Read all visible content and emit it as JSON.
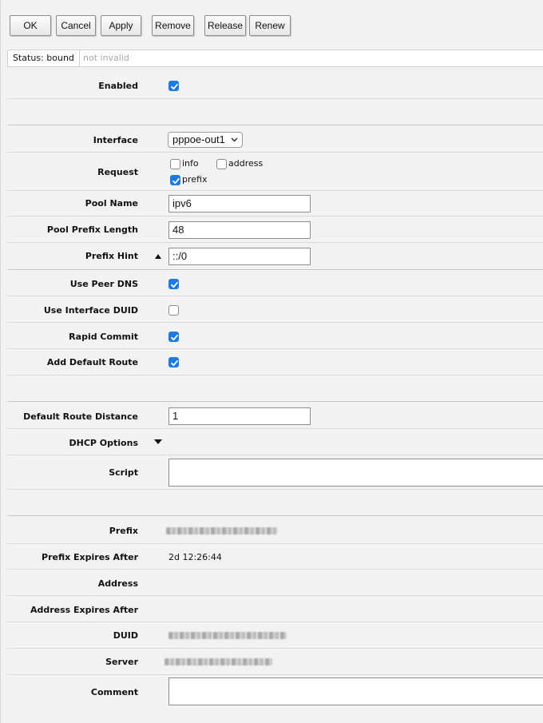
{
  "toolbar": {
    "ok": "OK",
    "cancel": "Cancel",
    "apply": "Apply",
    "remove": "Remove",
    "release": "Release",
    "renew": "Renew"
  },
  "status": {
    "label": "Status: bound",
    "sub": "not invalid"
  },
  "fields": {
    "enabled": {
      "label": "Enabled",
      "checked": true
    },
    "interface": {
      "label": "Interface",
      "value": "pppoe-out1"
    },
    "request": {
      "label": "Request",
      "options": [
        {
          "label": "info",
          "checked": false
        },
        {
          "label": "address",
          "checked": false
        },
        {
          "label": "prefix",
          "checked": true
        }
      ]
    },
    "pool_name": {
      "label": "Pool Name",
      "value": "ipv6"
    },
    "pool_prefix_length": {
      "label": "Pool Prefix Length",
      "value": "48"
    },
    "prefix_hint": {
      "label": "Prefix Hint",
      "value": "::/0"
    },
    "use_peer_dns": {
      "label": "Use Peer DNS",
      "checked": true
    },
    "use_interface_duid": {
      "label": "Use Interface DUID",
      "checked": false
    },
    "rapid_commit": {
      "label": "Rapid Commit",
      "checked": true
    },
    "add_default_route": {
      "label": "Add Default Route",
      "checked": true
    },
    "default_route_distance": {
      "label": "Default Route Distance",
      "value": "1"
    },
    "dhcp_options": {
      "label": "DHCP Options"
    },
    "script": {
      "label": "Script",
      "value": ""
    },
    "prefix": {
      "label": "Prefix"
    },
    "prefix_expires_after": {
      "label": "Prefix Expires After",
      "value": "2d 12:26:44"
    },
    "address": {
      "label": "Address",
      "value": ""
    },
    "address_expires_after": {
      "label": "Address Expires After",
      "value": ""
    },
    "duid": {
      "label": "DUID"
    },
    "server": {
      "label": "Server"
    },
    "comment": {
      "label": "Comment",
      "value": ""
    }
  },
  "colors": {
    "checkbox_accent": "#1f7ae0",
    "page_background": "#f2f2f2"
  },
  "icons": {
    "checkmark": "checkmark-icon",
    "select_arrow": "chevron-down-icon",
    "collapse": "triangle-up-icon",
    "expand": "triangle-down-icon"
  }
}
